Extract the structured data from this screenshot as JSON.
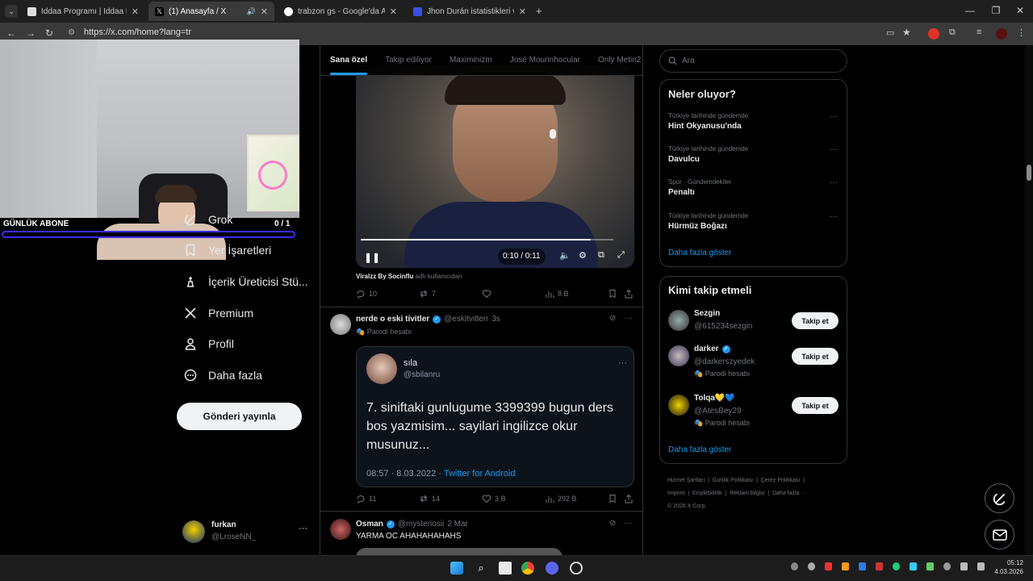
{
  "browser": {
    "tabs": [
      {
        "title": "İddaa Programı | İddaa Bülteni"
      },
      {
        "title": "(1) Anasayfa / X"
      },
      {
        "title": "trabzon gs - Google'da Ara"
      },
      {
        "title": "Jhon Durán istatistikleri ve reyti"
      }
    ],
    "url": "https://x.com/home?lang=tr"
  },
  "webcam": {
    "label": "GÜNLÜK ABONE",
    "count": "0 / 1"
  },
  "nav": {
    "items": [
      "Grok",
      "Yer İşaretleri",
      "İçerik Üreticisi Stü...",
      "Premium",
      "Profil",
      "Daha fazla"
    ],
    "post_button": "Gönderi yayınla",
    "account": {
      "name": "furkan",
      "handle": "@LroseNN_"
    }
  },
  "feed_tabs": [
    "Sana özel",
    "Takip ediliyor",
    "Maximinizm",
    "José Mourinhocular",
    "Only Metin2"
  ],
  "video_post": {
    "time": "0:10 / 0:11",
    "caption_source": "Viralzz By Socinflu",
    "caption_rest": "adlı kullanıcıdan",
    "replies": "10",
    "reposts": "7",
    "likes": "",
    "views": "8 B",
    "progress": 0.91
  },
  "post2": {
    "author": "nerde o eski tivitler",
    "handle": "@eskitvitlerr",
    "time": "3s",
    "badge": "Parodi hesabı",
    "quote": {
      "author": "sıla",
      "handle": "@sbilanru",
      "text": "7. siniftaki gunlugume 3399399 bugun ders bos yazmisim... sayilari ingilizce okur musunuz...",
      "date": "08:57 · 8.03.2022 ·",
      "source": "Twitter for Android"
    },
    "replies": "11",
    "reposts": "14",
    "likes": "3 B",
    "views": "292 B"
  },
  "post3": {
    "author": "Osman",
    "handle": "@mysteriosii",
    "time": "2 Mar",
    "text": "YARMA OC AHAHAHAHAHS"
  },
  "search": {
    "placeholder": "Ara"
  },
  "trends": {
    "title": "Neler oluyor?",
    "items": [
      {
        "category": "Türkiye tarihinde gündemde",
        "name": "Hint Okyanusu'nda"
      },
      {
        "category": "Türkiye tarihinde gündemde",
        "name": "Davulcu"
      },
      {
        "category": "Spor · Gündemdekiler",
        "name": "Penaltı"
      },
      {
        "category": "Türkiye tarihinde gündemde",
        "name": "Hürmüz Boğazı"
      }
    ],
    "more": "Daha fazla göster"
  },
  "who_to_follow": {
    "title": "Kimi takip etmeli",
    "users": [
      {
        "name": "Sezgin",
        "handle": "@615234sezgin",
        "badge": ""
      },
      {
        "name": "darker",
        "handle": "@darkerszyedek",
        "badge": "Parodi hesabı"
      },
      {
        "name": "Tolqa💛💙",
        "handle": "@AtesBey29",
        "badge": "Parodi hesabı"
      }
    ],
    "follow_label": "Takip et",
    "more": "Daha fazla göster"
  },
  "footer": {
    "links": [
      "Hizmet Şartları",
      "Gizlilik Politikası",
      "Çerez Politikası",
      "Imprint",
      "Erişilebilirlik",
      "Reklam bilgisi",
      "Daha fazla ···"
    ],
    "copyright": "© 2026 X Corp."
  },
  "taskbar": {
    "time": "05:12",
    "date": "4.03.2026"
  },
  "colors": {
    "accent": "#1d9bf0",
    "background": "#000000",
    "border": "#2f3336"
  }
}
